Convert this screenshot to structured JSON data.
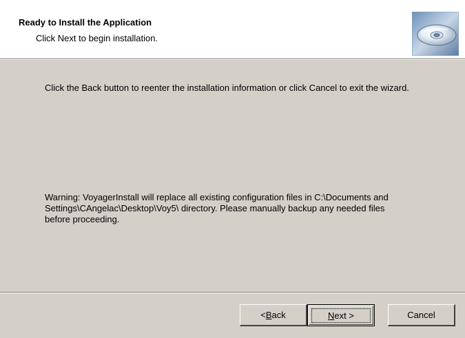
{
  "header": {
    "title": "Ready to Install the Application",
    "subtitle": "Click Next to begin installation.",
    "icon": "cd-disc-icon"
  },
  "body": {
    "intro": "Click the Back button to reenter the installation information or click Cancel to exit the wizard.",
    "warning": "Warning: VoyagerInstall will replace all existing configuration files in C:\\Documents and Settings\\CAngelac\\Desktop\\Voy5\\ directory. Please manually backup any needed files before proceeding."
  },
  "buttons": {
    "back_prefix": "< ",
    "back_mnemonic": "B",
    "back_rest": "ack",
    "next_mnemonic": "N",
    "next_rest": "ext >",
    "cancel": "Cancel"
  },
  "colors": {
    "dialog_bg": "#d4d0c8",
    "header_bg": "#ffffff"
  }
}
